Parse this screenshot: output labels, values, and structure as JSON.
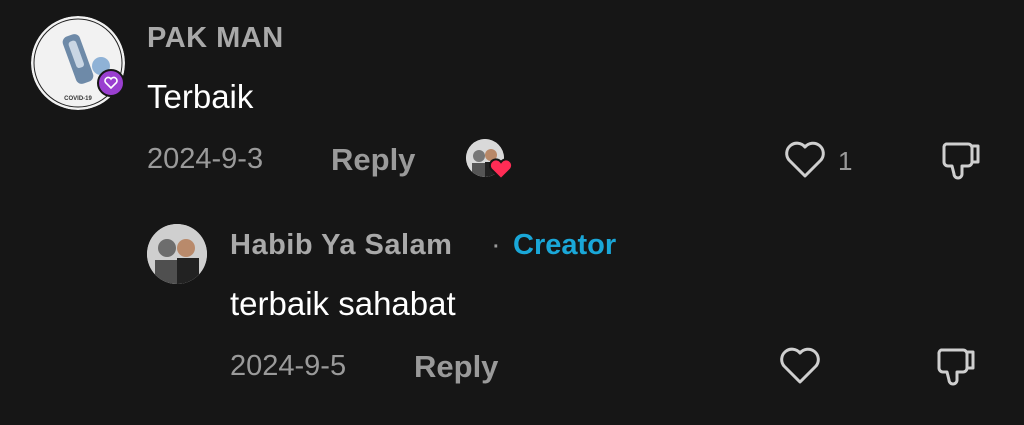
{
  "comment": {
    "username": "PAK MAN",
    "text": "Terbaik",
    "date": "2024-9-3",
    "reply_label": "Reply",
    "like_count": "1",
    "avatar_text": "SAYA TERIMA VAKSIN COVID-19 SAYA"
  },
  "reply": {
    "username": "Habib Ya Salam",
    "separator": "·",
    "badge": "Creator",
    "text": "terbaik sahabat",
    "date": "2024-9-5",
    "reply_label": "Reply"
  },
  "colors": {
    "background": "#161616",
    "creator_badge": "#1aa7d8",
    "heart_badge": "#ff2c55"
  }
}
